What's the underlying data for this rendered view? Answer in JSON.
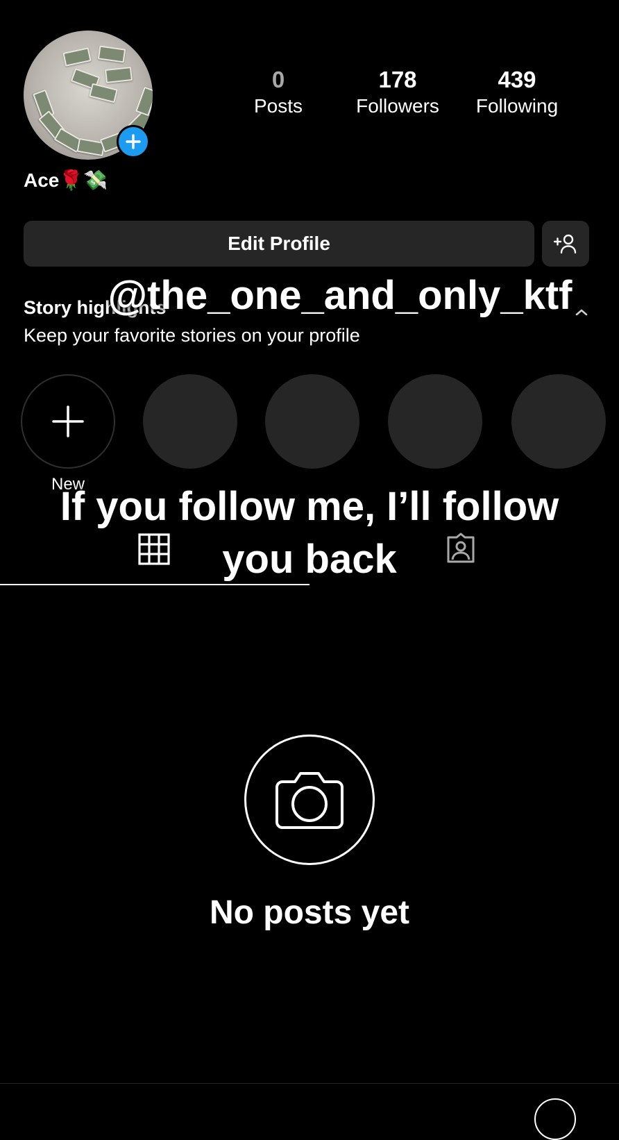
{
  "profile": {
    "display_name": "Ace🌹💸",
    "stats": [
      {
        "value": "0",
        "label": "Posts"
      },
      {
        "value": "178",
        "label": "Followers"
      },
      {
        "value": "439",
        "label": "Following"
      }
    ],
    "edit_profile_label": "Edit Profile"
  },
  "highlights": {
    "title": "Story highlights",
    "subtitle": "Keep your favorite stories on your profile",
    "new_label": "New"
  },
  "empty_state": {
    "message": "No posts yet"
  },
  "overlay": {
    "handle": "@the_one_and_only_ktf",
    "line1": "If you follow me, I’ll follow",
    "line2": "you back"
  },
  "colors": {
    "background": "#000000",
    "button_bg": "#262626",
    "accent_blue": "#1d9bf0",
    "text": "#ffffff"
  },
  "icons": [
    "plus-icon",
    "add-person-icon",
    "chevron-up-icon",
    "grid-icon",
    "tagged-icon",
    "camera-icon"
  ]
}
